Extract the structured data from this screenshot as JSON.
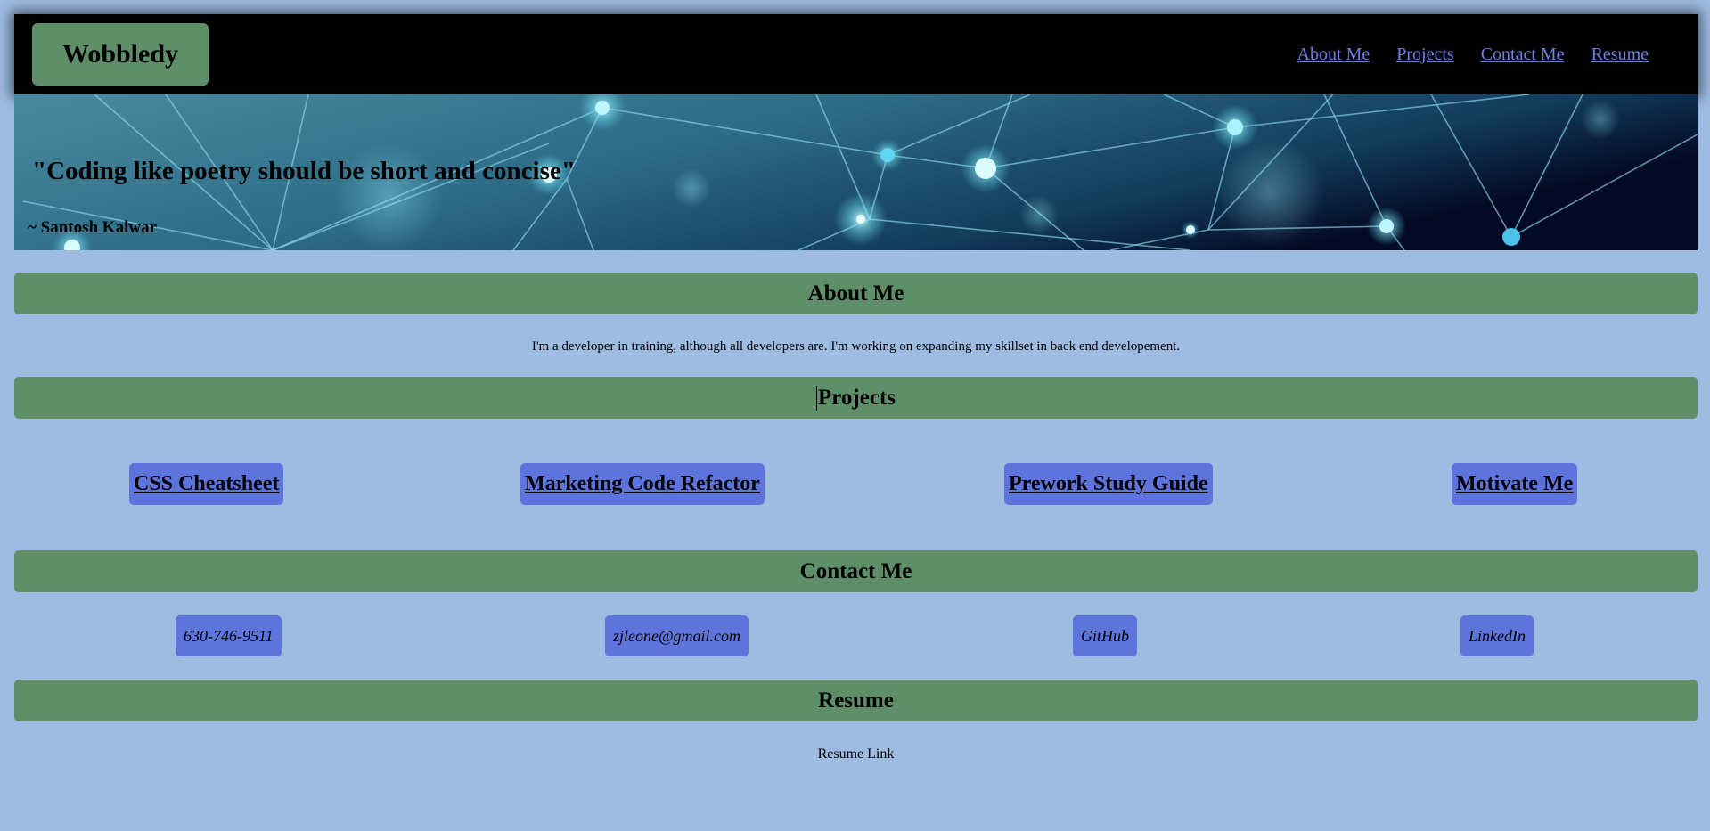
{
  "header": {
    "logo_text": "Wobbledy",
    "nav": [
      "About Me",
      "Projects",
      "Contact Me",
      "Resume"
    ],
    "nav_link_color": "#6f7ee6"
  },
  "hero": {
    "quote": "\"Coding like poetry should be short and concise\"",
    "author": "~ Santosh Kalwar"
  },
  "about": {
    "title": "About Me",
    "text": "I'm a developer in training, although all developers are. I'm working on expanding my skillset in back end developement."
  },
  "projects": {
    "title": "Projects",
    "items": [
      "CSS Cheatsheet",
      "Marketing Code Refactor",
      "Prework Study Guide",
      "Motivate Me"
    ]
  },
  "contact": {
    "title": "Contact Me",
    "phone": "630-746-9511",
    "email": "zjleone@gmail.com",
    "github": "GitHub",
    "linkedin": "LinkedIn"
  },
  "resume": {
    "title": "Resume",
    "link_text": "Resume Link"
  },
  "colors": {
    "page_background": "#9ebce2",
    "section_bar": "#5e8f69",
    "button": "#5c74dc",
    "header_background": "#000000"
  }
}
